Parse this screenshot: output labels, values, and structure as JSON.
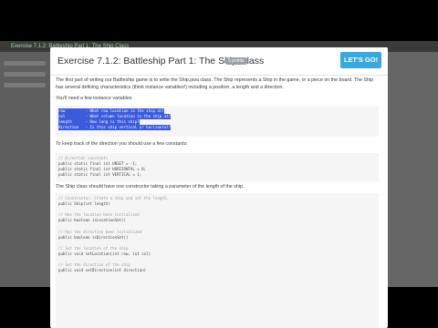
{
  "background_app": {
    "title": "Exercise 7.1.2: Battleship Part 1: The Ship Class"
  },
  "modal": {
    "title": "Exercise 7.1.2: Battleship Part 1: The Ship Class",
    "badge": "5 points",
    "lets_go_label": "LET'S GO!",
    "intro": "The first part of writing our Battleship game is to write the Ship.java class. The Ship represents a Ship in the game, or a piece on the board. The Ship has several defining characteristics (think instance variables!) including a position, a length and a direction.",
    "instance_vars_label": "You'll need a few instance variables",
    "instance_vars_code": [
      "row         - What row location is the ship at?",
      "col         - What column location is the ship at?",
      "length      - How long is this ship?",
      "direction   - Is this ship vertical or horizontal?"
    ],
    "constants_label": "To keep track of the direction you should use a few constants:",
    "constants_code": [
      "// Direction constants",
      "public static final int UNSET = -1;",
      "public static final int HORIZONTAL = 0;",
      "public static final int VERTICAL = 1;"
    ],
    "constructor_label": "The Ship class should have one constructor taking a parameter of the length of the ship.",
    "methods_code": [
      "// Constructor. Create a ship and set the length.",
      "public Ship(int length)",
      "",
      "// Has the location been initialized",
      "public boolean isLocationSet()",
      "",
      "// Has the direction been initialized",
      "public boolean isDirectionSet()",
      "",
      "// Set the location of the ship",
      "public void setLocation(int row, int col)",
      "",
      "// Set the direction of the ship",
      "public void setDirection(int direction)"
    ]
  }
}
